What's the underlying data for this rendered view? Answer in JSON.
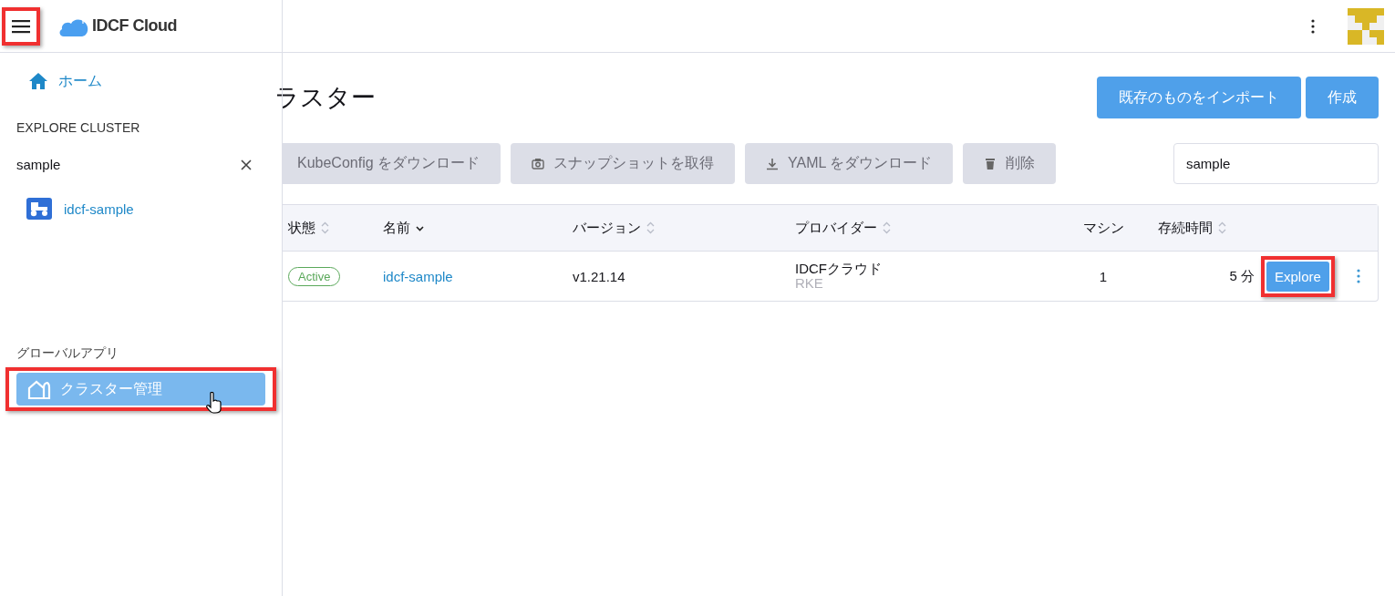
{
  "brand": {
    "menu_highlighted": true,
    "name": "IDCF Cloud"
  },
  "sidebar": {
    "home": "ホーム",
    "explore_heading": "EXPLORE CLUSTER",
    "search": {
      "value": "sample"
    },
    "clusters": [
      {
        "name": "idcf-sample"
      }
    ],
    "global_heading": "グローバルアプリ",
    "global_apps": [
      {
        "label": "クラスター管理",
        "selected": true,
        "highlighted": true
      }
    ]
  },
  "page": {
    "title": "ラスター",
    "header_buttons": [
      "既存のものをインポート",
      "作成"
    ],
    "actions": [
      {
        "label": "KubeConfig をダウンロード",
        "kind": "plain"
      },
      {
        "label": "スナップショットを取得",
        "kind": "snapshot"
      },
      {
        "label": "YAML をダウンロード",
        "kind": "download"
      },
      {
        "label": "削除",
        "kind": "delete"
      }
    ],
    "filter": {
      "value": "sample"
    }
  },
  "table": {
    "columns": [
      {
        "label": "状態",
        "kind": "sortable"
      },
      {
        "label": "名前",
        "kind": "sorted"
      },
      {
        "label": "バージョン",
        "kind": "sortable"
      },
      {
        "label": "プロバイダー",
        "kind": "sortable"
      },
      {
        "label": "マシン",
        "kind": "plain"
      },
      {
        "label": "存続時間",
        "kind": "sortable"
      }
    ],
    "rows": [
      {
        "state": "Active",
        "name": "idcf-sample",
        "version": "v1.21.14",
        "provider": "IDCFクラウド",
        "provider_sub": "RKE",
        "machines": "1",
        "age": "5 分",
        "action": "Explore",
        "action_highlighted": true
      }
    ]
  }
}
